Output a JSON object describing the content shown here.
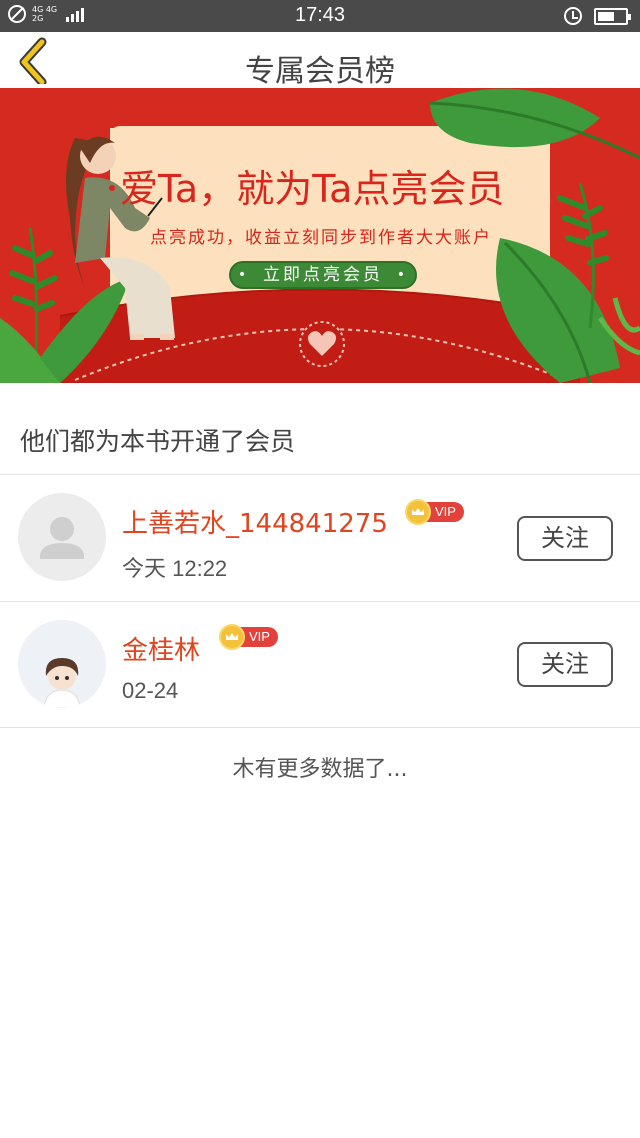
{
  "status_bar": {
    "time": "17:43",
    "network_top": "4G 4G",
    "network_bottom": "2G",
    "icons": [
      "do-not-disturb-icon",
      "signal-icon",
      "alarm-icon",
      "battery-icon"
    ]
  },
  "nav": {
    "title": "专属会员榜",
    "back_icon": "chevron-left-icon"
  },
  "banner": {
    "headline": "爱Ta，就为Ta点亮会员",
    "subtitle": "点亮成功，收益立刻同步到作者大大账户",
    "cta": "立即点亮会员"
  },
  "section": {
    "heading": "他们都为本书开通了会员"
  },
  "members": [
    {
      "name": "上善若水_144841275",
      "badge": "VIP",
      "time": "今天 12:22",
      "follow": "关注"
    },
    {
      "name": "金桂林",
      "badge": "VIP",
      "time": "02-24",
      "follow": "关注"
    }
  ],
  "footer": {
    "no_more": "木有更多数据了..."
  },
  "colors": {
    "accent": "#e0451f",
    "banner_red": "#d52a1f",
    "cta_green": "#3c8a35",
    "back_yellow": "#f0c419"
  }
}
